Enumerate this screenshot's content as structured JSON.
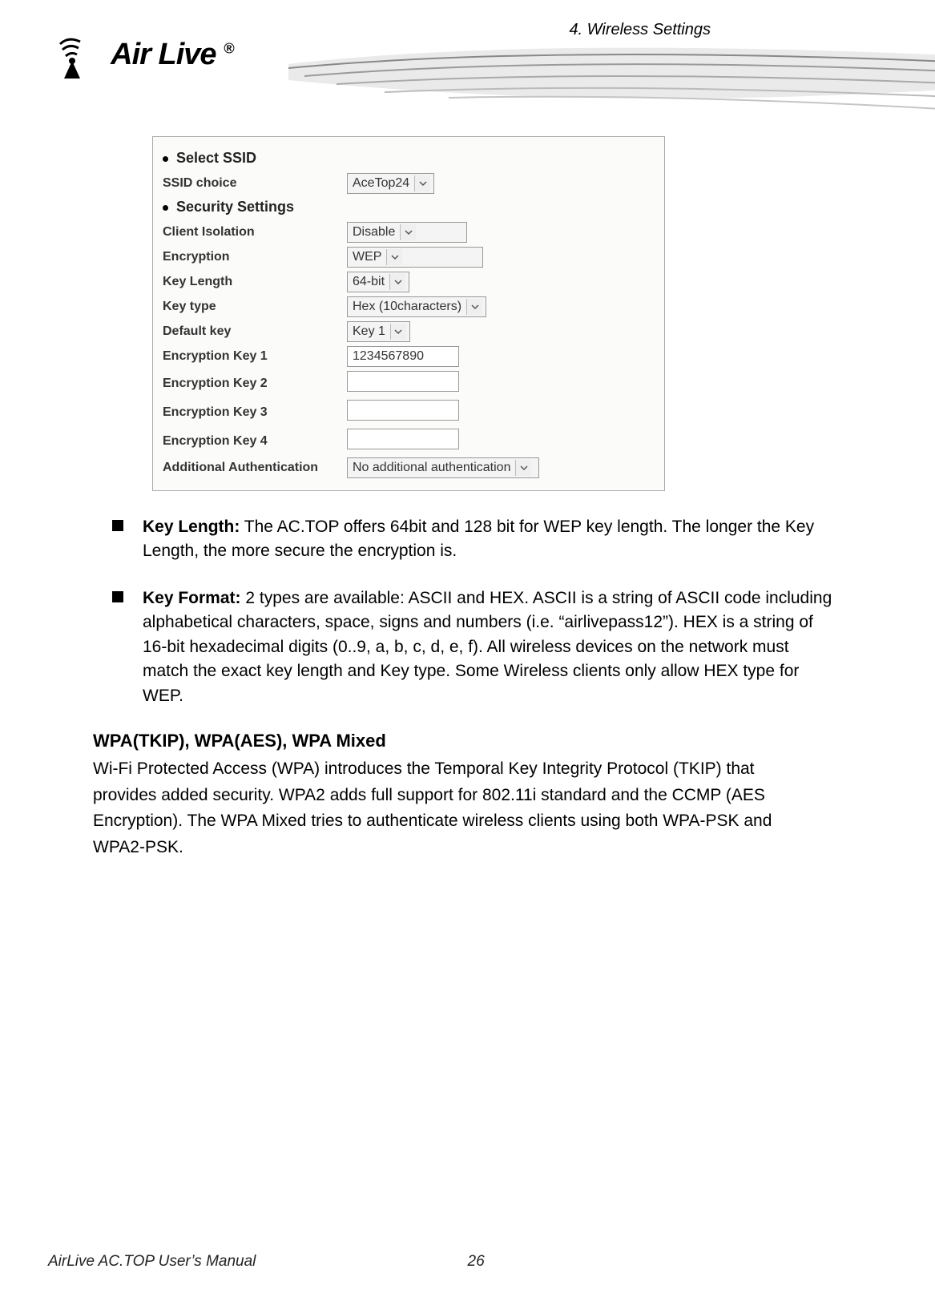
{
  "header": {
    "chapter": "4. Wireless Settings",
    "brand": "Air Live"
  },
  "config": {
    "section_ssid": "Select SSID",
    "ssid_choice_label": "SSID choice",
    "ssid_choice_value": "AceTop24",
    "section_security": "Security Settings",
    "client_isolation_label": "Client Isolation",
    "client_isolation_value": "Disable",
    "encryption_label": "Encryption",
    "encryption_value": "WEP",
    "key_length_label": "Key Length",
    "key_length_value": "64-bit",
    "key_type_label": "Key type",
    "key_type_value": "Hex (10characters)",
    "default_key_label": "Default key",
    "default_key_value": "Key 1",
    "enc_key1_label": "Encryption Key 1",
    "enc_key1_value": "1234567890",
    "enc_key2_label": "Encryption Key 2",
    "enc_key2_value": "",
    "enc_key3_label": "Encryption Key 3",
    "enc_key3_value": "",
    "enc_key4_label": "Encryption Key 4",
    "enc_key4_value": "",
    "add_auth_label": "Additional Authentication",
    "add_auth_value": "No additional authentication"
  },
  "bullets": {
    "key_length_lead": "Key Length:",
    "key_length_text": " The AC.TOP offers 64bit and 128 bit for WEP key length. The longer the Key Length, the more secure the encryption is.",
    "key_format_lead": "Key Format:",
    "key_format_text": " 2 types are available: ASCII and HEX. ASCII is a string of ASCII code including alphabetical characters, space, signs and numbers (i.e. “airlivepass12”). HEX is a string of 16-bit hexadecimal digits (0..9, a, b, c, d, e, f). All wireless devices on the network must match the exact key length and Key type. Some Wireless clients only allow HEX type for WEP."
  },
  "wpa": {
    "heading": "WPA(TKIP), WPA(AES), WPA Mixed",
    "body": "Wi-Fi Protected Access (WPA) introduces the Temporal Key Integrity Protocol (TKIP) that provides added security. WPA2 adds full support for 802.11i standard and the CCMP (AES Encryption). The WPA Mixed tries to authenticate wireless clients using both WPA-PSK and WPA2-PSK."
  },
  "footer": {
    "manual_title": "AirLive AC.TOP User’s Manual",
    "page_number": "26"
  }
}
